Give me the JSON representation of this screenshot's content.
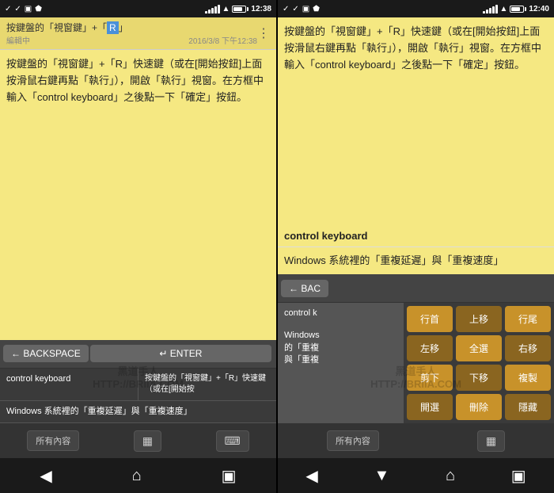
{
  "left_panel": {
    "status_bar": {
      "icons_left": [
        "check",
        "checkmark",
        "window",
        "android"
      ],
      "signal": "full",
      "wifi": "wifi",
      "battery_pct": "78%",
      "time": "12:38"
    },
    "note": {
      "title_prefix": "按鍵盤的「視窗鍵」+「",
      "title_highlight": "R",
      "title_suffix": "」",
      "status": "編輯中",
      "date": "2016/3/8 下午12:38",
      "content": "按鍵盤的「視窗鍵」+「R」快速鍵（或在[開始按鈕]上面按滑鼠右鍵再點「執行」），開啟「執行」視窗。在方框中輸入「control keyboard」之後點一下「確定」按鈕。"
    },
    "autocomplete": {
      "backspace_label": "← BACKSPACE",
      "enter_label": "↵ ENTER"
    },
    "suggestions": [
      {
        "col1": "control keyboard",
        "col2": "按鍵盤的「視窗鍵」+「R」快速鍵（或在[開始按"
      },
      {
        "col1": "Windows 系統裡的「重複延遲」與「重複速度」",
        "col2": ""
      }
    ],
    "bottom_bar": {
      "left_label": "所有內容",
      "right_icons": [
        "grid",
        "keyboard"
      ]
    },
    "nav_bar": {
      "back": "◀",
      "home": "▼",
      "recent": "⌂",
      "tabs": "▣"
    },
    "watermark": "黑道手人\nHTTP://BRIIA.COM"
  },
  "right_panel": {
    "status_bar": {
      "signal": "full",
      "wifi": "wifi",
      "battery_pct": "77%",
      "time": "12:40"
    },
    "note": {
      "content_main": "按鍵盤的「視窗鍵」+「R」快速鍵（或在[開始按鈕]上面按滑鼠右鍵再點「執行」），開啟「執行」視窗。在方框中輸入「control keyboard」之後點一下「確定」按鈕。",
      "section1": "control keyboard",
      "section2": "Windows 系統裡的「重複延遲」與「重複速度」"
    },
    "autocomplete": {
      "backspace_label": "← BAC"
    },
    "action_grid": [
      [
        "行首",
        "上移",
        "行尾"
      ],
      [
        "左移",
        "全選",
        "右移"
      ],
      [
        "剪下",
        "下移",
        "複製"
      ],
      [
        "開選",
        "刪除",
        "隱藏"
      ]
    ],
    "suggestions": [
      {
        "col1": "control k",
        "col2": "Windows\n的「重複\n與「重複"
      }
    ],
    "bottom_bar": {
      "left_label": "所有內容",
      "right_icons": [
        "grid"
      ]
    },
    "nav_bar": {
      "back": "◀",
      "down": "▼",
      "home": "⌂",
      "tabs": "▣"
    }
  }
}
